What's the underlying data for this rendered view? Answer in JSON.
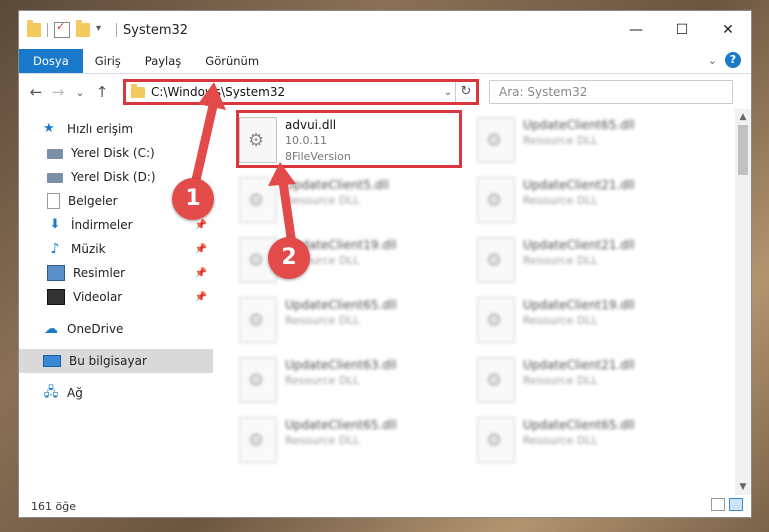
{
  "window": {
    "title": "System32",
    "controls": {
      "minimize": "—",
      "maximize": "☐",
      "close": "✕"
    }
  },
  "ribbon": {
    "tabs": [
      "Dosya",
      "Giriş",
      "Paylaş",
      "Görünüm"
    ],
    "help": "?"
  },
  "nav": {
    "back": "←",
    "forward": "→",
    "recent": "⌄",
    "up": "↑",
    "address": "C:\\Windows\\System32",
    "refresh": "↻",
    "search_placeholder": "Ara: System32"
  },
  "sidebar": {
    "items": [
      {
        "label": "Hızlı erişim",
        "icon": "star-icon"
      },
      {
        "label": "Yerel Disk (C:)",
        "icon": "drive-icon"
      },
      {
        "label": "Yerel Disk (D:)",
        "icon": "drive-icon"
      },
      {
        "label": "Belgeler",
        "icon": "document-icon"
      },
      {
        "label": "İndirmeler",
        "icon": "download-icon"
      },
      {
        "label": "Müzik",
        "icon": "music-icon"
      },
      {
        "label": "Resimler",
        "icon": "pictures-icon"
      },
      {
        "label": "Videolar",
        "icon": "video-icon"
      },
      {
        "label": "OneDrive",
        "icon": "cloud-icon"
      },
      {
        "label": "Bu bilgisayar",
        "icon": "computer-icon"
      },
      {
        "label": "Ağ",
        "icon": "network-icon"
      }
    ]
  },
  "files": [
    {
      "name": "advui.dll",
      "line1": "10.0.11",
      "line2": "8FileVersion"
    },
    {
      "name": "UpdateClient65.dll",
      "line1": "Resource DLL"
    },
    {
      "name": "UpdateClient5.dll",
      "line1": "Resource DLL"
    },
    {
      "name": "UpdateClient21.dll",
      "line1": "Resource DLL"
    },
    {
      "name": "UpdateClient19.dll",
      "line1": "Resource DLL"
    },
    {
      "name": "UpdateClient21.dll",
      "line1": "Resource DLL"
    },
    {
      "name": "UpdateClient65.dll",
      "line1": "Resource DLL"
    },
    {
      "name": "UpdateClient19.dll",
      "line1": "Resource DLL"
    },
    {
      "name": "UpdateClient63.dll",
      "line1": "Resource DLL"
    },
    {
      "name": "UpdateClient21.dll",
      "line1": "Resource DLL"
    },
    {
      "name": "UpdateClient65.dll",
      "line1": "Resource DLL"
    },
    {
      "name": "UpdateClient65.dll",
      "line1": "Resource DLL"
    }
  ],
  "status": {
    "count": "161 öğe"
  },
  "annotations": [
    "1",
    "2"
  ],
  "colors": {
    "accent": "#1979ca",
    "highlight": "#d9363e",
    "callout": "#e34a4a"
  }
}
